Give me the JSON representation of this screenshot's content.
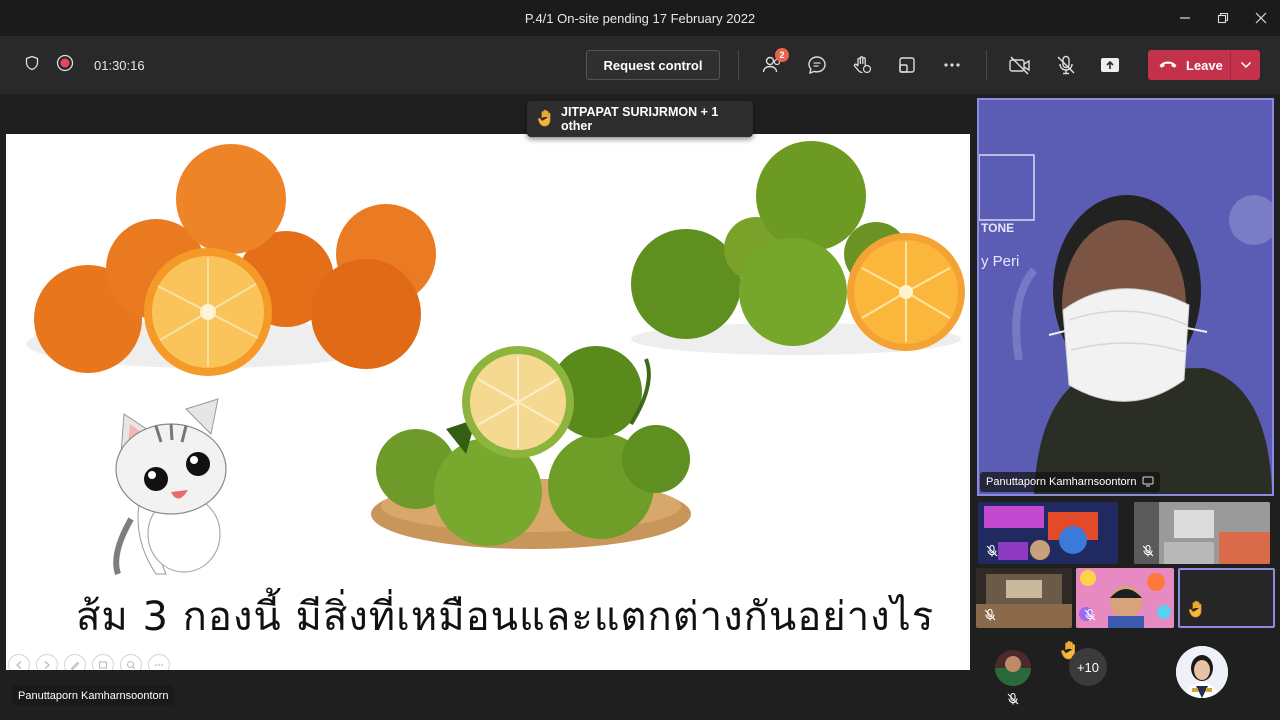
{
  "window": {
    "title": "P.4/1 On-site pending 17 February 2022"
  },
  "toolbar": {
    "timer": "01:30:16",
    "request_control": "Request control",
    "participants_badge": "2",
    "leave_label": "Leave",
    "icons": [
      "shield-icon",
      "record-icon",
      "participants-icon",
      "chat-icon",
      "reactions-icon",
      "rooms-icon",
      "more-icon",
      "camera-off-icon",
      "mic-off-icon",
      "share-icon",
      "phone-icon",
      "chevron-down-icon"
    ]
  },
  "raise_hand": {
    "text": "JITPAPAT SURIJRMON + 1 other"
  },
  "slide": {
    "caption": "ส้ม 3 กองนี้ มีสิ่งที่เหมือนและแตกต่างกันอย่างไร"
  },
  "presenter": {
    "name": "Panuttaporn Kamharnsoontorn"
  },
  "main_video": {
    "name": "Panuttaporn Kamharnsoontorn",
    "bg_text_1": "TONE",
    "bg_text_2": "y Peri"
  },
  "gallery": {
    "overflow_count": "+10"
  },
  "colors": {
    "accent": "#8b8ce0",
    "leave": "#c4314b",
    "badge": "#e8654a"
  }
}
